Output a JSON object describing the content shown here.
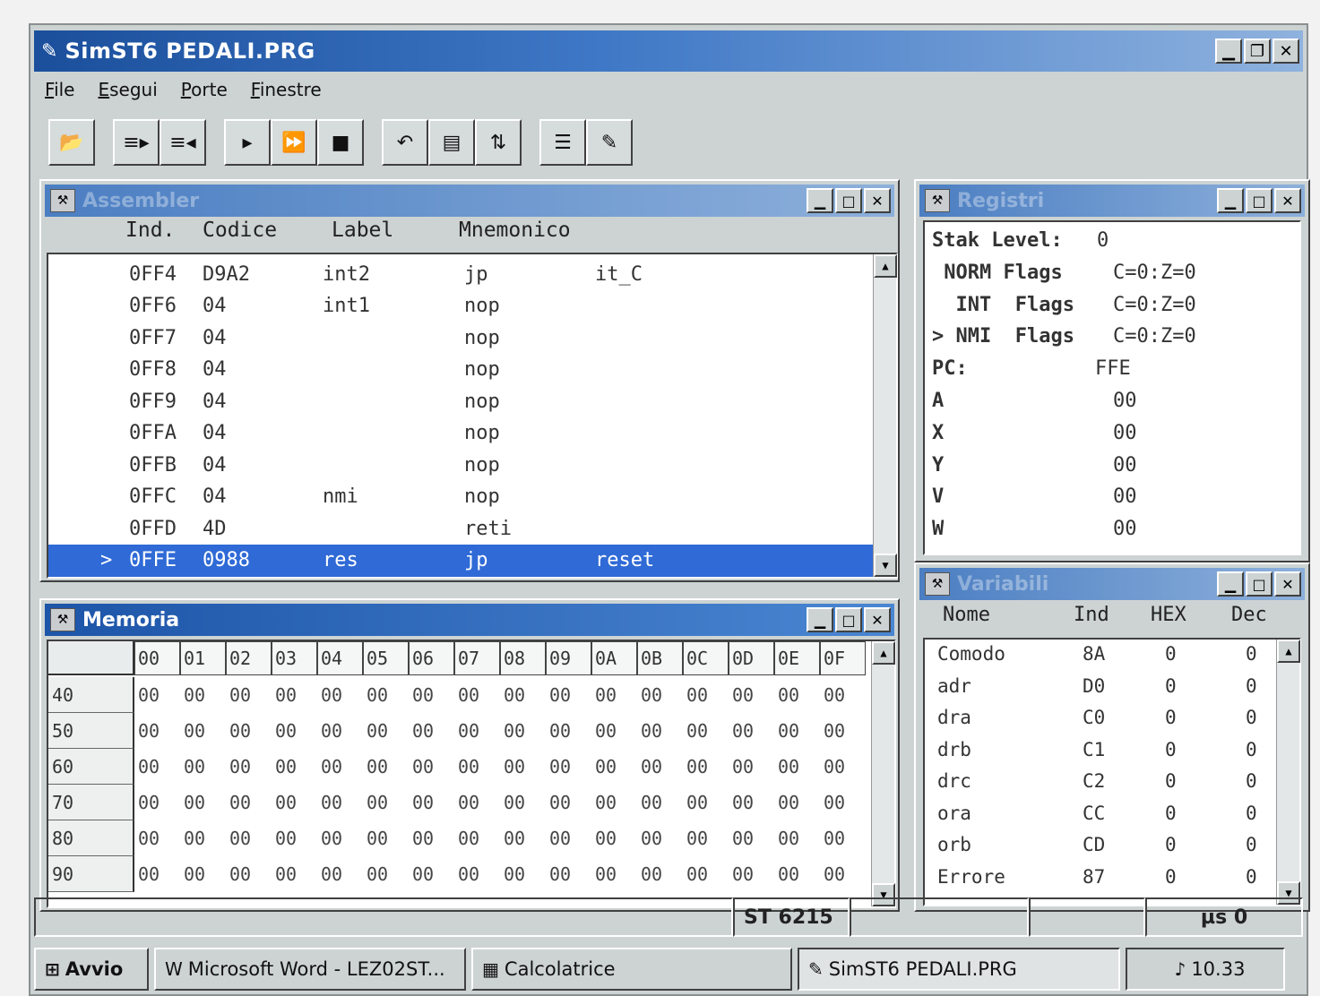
{
  "window": {
    "title": "SimST6  PEDALI.PRG"
  },
  "menu": [
    "File",
    "Esegui",
    "Porte",
    "Finestre"
  ],
  "toolbar": {
    "groups": [
      [
        "open-icon"
      ],
      [
        "step-into-icon",
        "step-out-icon"
      ],
      [
        "run-icon",
        "fast-run-icon",
        "stop-icon"
      ],
      [
        "window-a-icon",
        "window-b-icon",
        "window-c-icon"
      ],
      [
        "list-icon",
        "tag-icon"
      ]
    ]
  },
  "assembler": {
    "title": "Assembler",
    "columns": [
      "Ind.",
      "Codice",
      "Label",
      "Mnemonico"
    ],
    "rows": [
      {
        "marker": "",
        "ind": "0FF4",
        "code": "D9A2",
        "label": "int2",
        "mnem": "jp",
        "operand": "it_C"
      },
      {
        "marker": "",
        "ind": "0FF6",
        "code": "04",
        "label": "int1",
        "mnem": "nop",
        "operand": ""
      },
      {
        "marker": "",
        "ind": "0FF7",
        "code": "04",
        "label": "",
        "mnem": "nop",
        "operand": ""
      },
      {
        "marker": "",
        "ind": "0FF8",
        "code": "04",
        "label": "",
        "mnem": "nop",
        "operand": ""
      },
      {
        "marker": "",
        "ind": "0FF9",
        "code": "04",
        "label": "",
        "mnem": "nop",
        "operand": ""
      },
      {
        "marker": "",
        "ind": "0FFA",
        "code": "04",
        "label": "",
        "mnem": "nop",
        "operand": ""
      },
      {
        "marker": "",
        "ind": "0FFB",
        "code": "04",
        "label": "",
        "mnem": "nop",
        "operand": ""
      },
      {
        "marker": "",
        "ind": "0FFC",
        "code": "04",
        "label": "nmi",
        "mnem": "nop",
        "operand": ""
      },
      {
        "marker": "",
        "ind": "0FFD",
        "code": "4D",
        "label": "",
        "mnem": "reti",
        "operand": ""
      },
      {
        "marker": ">",
        "ind": "0FFE",
        "code": "0988",
        "label": "res",
        "mnem": "jp",
        "operand": "reset"
      }
    ],
    "selected_index": 9
  },
  "registri": {
    "title": "Registri",
    "lines": [
      {
        "text": "Stak Level:",
        "value": "0"
      },
      {
        "text": " NORM Flags",
        "value": "C=0:Z=0"
      },
      {
        "text": "  INT  Flags",
        "value": "C=0:Z=0"
      },
      {
        "text": "> NMI  Flags",
        "value": "C=0:Z=0"
      },
      {
        "text": "PC:",
        "value": "FFE"
      },
      {
        "text": "A",
        "value": "00"
      },
      {
        "text": "X",
        "value": "00"
      },
      {
        "text": "Y",
        "value": "00"
      },
      {
        "text": "V",
        "value": "00"
      },
      {
        "text": "W",
        "value": "00"
      }
    ]
  },
  "variabili": {
    "title": "Variabili",
    "columns": [
      "Nome",
      "Ind",
      "HEX",
      "Dec"
    ],
    "rows": [
      {
        "nome": "Comodo",
        "ind": "8A",
        "hex": "0",
        "dec": "0"
      },
      {
        "nome": "adr",
        "ind": "D0",
        "hex": "0",
        "dec": "0"
      },
      {
        "nome": "dra",
        "ind": "C0",
        "hex": "0",
        "dec": "0"
      },
      {
        "nome": "drb",
        "ind": "C1",
        "hex": "0",
        "dec": "0"
      },
      {
        "nome": "drc",
        "ind": "C2",
        "hex": "0",
        "dec": "0"
      },
      {
        "nome": "ora",
        "ind": "CC",
        "hex": "0",
        "dec": "0"
      },
      {
        "nome": "orb",
        "ind": "CD",
        "hex": "0",
        "dec": "0"
      },
      {
        "nome": "Errore",
        "ind": "87",
        "hex": "0",
        "dec": "0"
      }
    ]
  },
  "memoria": {
    "title": "Memoria",
    "columns": [
      "00",
      "01",
      "02",
      "03",
      "04",
      "05",
      "06",
      "07",
      "08",
      "09",
      "0A",
      "0B",
      "0C",
      "0D",
      "0E",
      "0F"
    ],
    "rows": [
      {
        "addr": "40",
        "cells": [
          "00",
          "00",
          "00",
          "00",
          "00",
          "00",
          "00",
          "00",
          "00",
          "00",
          "00",
          "00",
          "00",
          "00",
          "00",
          "00"
        ]
      },
      {
        "addr": "50",
        "cells": [
          "00",
          "00",
          "00",
          "00",
          "00",
          "00",
          "00",
          "00",
          "00",
          "00",
          "00",
          "00",
          "00",
          "00",
          "00",
          "00"
        ]
      },
      {
        "addr": "60",
        "cells": [
          "00",
          "00",
          "00",
          "00",
          "00",
          "00",
          "00",
          "00",
          "00",
          "00",
          "00",
          "00",
          "00",
          "00",
          "00",
          "00"
        ]
      },
      {
        "addr": "70",
        "cells": [
          "00",
          "00",
          "00",
          "00",
          "00",
          "00",
          "00",
          "00",
          "00",
          "00",
          "00",
          "00",
          "00",
          "00",
          "00",
          "00"
        ]
      },
      {
        "addr": "80",
        "cells": [
          "00",
          "00",
          "00",
          "00",
          "00",
          "00",
          "00",
          "00",
          "00",
          "00",
          "00",
          "00",
          "00",
          "00",
          "00",
          "00"
        ]
      },
      {
        "addr": "90",
        "cells": [
          "00",
          "00",
          "00",
          "00",
          "00",
          "00",
          "00",
          "00",
          "00",
          "00",
          "00",
          "00",
          "00",
          "00",
          "00",
          "00"
        ]
      }
    ]
  },
  "status": {
    "device": "ST 6215",
    "time": "µs  0"
  },
  "taskbar": {
    "start": "Avvio",
    "items": [
      "Microsoft Word - LEZ02ST...",
      "Calcolatrice",
      "SimST6  PEDALI.PRG"
    ],
    "clock": "10.33"
  }
}
